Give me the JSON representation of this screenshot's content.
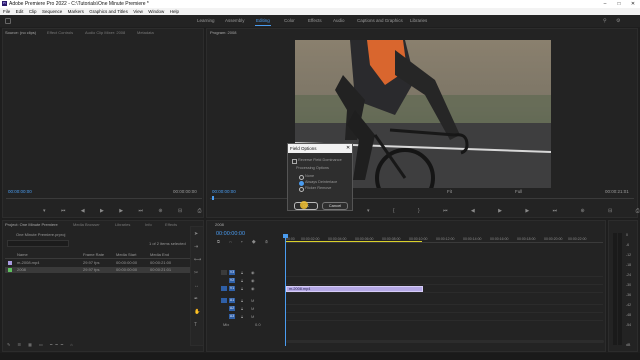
{
  "window": {
    "title": "Adobe Premiere Pro 2022 - C:\\Tutorials\\One Minute Premiere *",
    "logo_text": "Pr",
    "minimize": "–",
    "maximize": "□",
    "close": "✕"
  },
  "menu": [
    "File",
    "Edit",
    "Clip",
    "Sequence",
    "Markers",
    "Graphics and Titles",
    "View",
    "Window",
    "Help"
  ],
  "workspaces": [
    "Learning",
    "Assembly",
    "Editing",
    "Color",
    "Effects",
    "Audio",
    "Captions and Graphics",
    "Libraries"
  ],
  "active_workspace": "Editing",
  "source_panel": {
    "tabs": [
      "Source: (no clips)",
      "Effect Controls",
      "Audio Clip Mixer: 2008",
      "Metadata"
    ],
    "timecode_left": "00:00:00:00",
    "timecode_right": "00:00:00:00"
  },
  "program_panel": {
    "tab": "Program: 2008",
    "timecode_left": "00:00:00:00",
    "fit": "Fit",
    "full": "Full",
    "timecode_right": "00:00:21:01"
  },
  "dialog": {
    "title": "Field Options",
    "checkbox_label": "Reverse Field Dominance",
    "group_label": "Processing Options",
    "options": [
      "None",
      "Always Deinterlace",
      "Flicker Remove"
    ],
    "selected_option": "Always Deinterlace",
    "ok_label": "OK",
    "cancel_label": "Cancel"
  },
  "project_panel": {
    "tabs": [
      "Project: One Minute Premiere",
      "Media Browser",
      "Libraries",
      "Info",
      "Effects"
    ],
    "path": "One Minute Premiere.prproj",
    "selection": "1 of 2 items selected",
    "columns": [
      "Name",
      "Frame Rate",
      "Media Start",
      "Media End"
    ],
    "rows": [
      {
        "name": "m-2008.mp4",
        "frame_rate": "29.97 fps",
        "media_start": "00:00:00:00",
        "media_end": "00:00:21:00",
        "color": "#a99be0"
      },
      {
        "name": "2008",
        "frame_rate": "29.97 fps",
        "media_start": "00:00:00:00",
        "media_end": "00:00:21:01",
        "color": "#5fbf5f"
      }
    ]
  },
  "timeline": {
    "tab": "2008",
    "timecode": "00:00:00:00",
    "ruler": [
      "00:00",
      "00:00:02:00",
      "00:00:04:00",
      "00:00:06:00",
      "00:00:08:00",
      "00:00:10:00",
      "00:00:12:00",
      "00:00:14:00",
      "00:00:16:00",
      "00:00:18:00",
      "00:00:20:00",
      "00:00:22:00",
      "00:00:24:00",
      "00:00:26:00"
    ],
    "video_tracks": [
      "V3",
      "V2",
      "V1"
    ],
    "audio_tracks": [
      "A1",
      "A2",
      "A3"
    ],
    "clip_label": "m-2008.mp4",
    "master": "Mix",
    "master_value": "0.0"
  },
  "meters": [
    "0",
    "-6",
    "-12",
    "-18",
    "-24",
    "-30",
    "-36",
    "-42",
    "-48",
    "-54",
    "dB"
  ],
  "icons": [
    "hand-icon",
    "zoom-icon",
    "razor-icon",
    "selection-icon",
    "play-icon",
    "marker-icon",
    "export-icon"
  ]
}
